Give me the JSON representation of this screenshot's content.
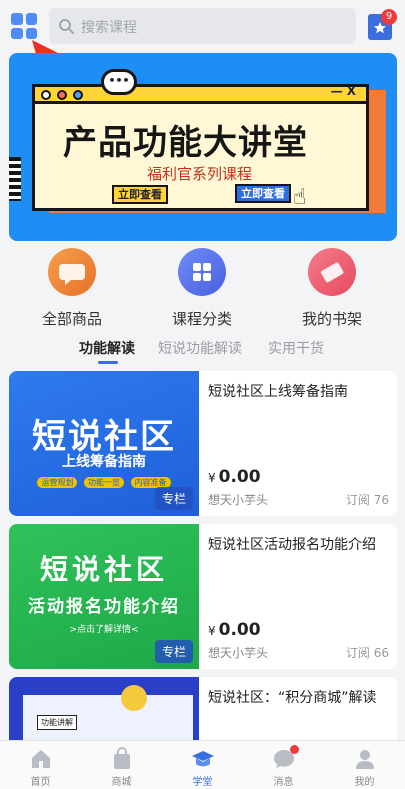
{
  "header": {
    "search_placeholder": "搜索课程",
    "cart_badge": "9"
  },
  "banner": {
    "title": "产品功能大讲堂",
    "subtitle": "福利官系列课程",
    "button_left": "立即查看",
    "button_right": "立即查看",
    "window_controls": "— X"
  },
  "categories": [
    {
      "label": "全部商品",
      "icon": "chat-bubble-icon",
      "color": "#ee8b3a"
    },
    {
      "label": "课程分类",
      "icon": "grid-icon",
      "color": "#5a74ec"
    },
    {
      "label": "我的书架",
      "icon": "ticket-icon",
      "color": "#ee5b6b"
    }
  ],
  "tabs": [
    {
      "label": "功能解读",
      "active": true
    },
    {
      "label": "短说功能解读",
      "active": false
    },
    {
      "label": "实用干货",
      "active": false
    }
  ],
  "courses": [
    {
      "cover_title": "短说社区",
      "cover_subtitle": "上线筹备指南",
      "cover_chips": [
        "运营规划",
        "功能一览",
        "内容准备"
      ],
      "cover_tag": "专栏",
      "title": "短说社区上线筹备指南",
      "price_symbol": "¥",
      "price": "0.00",
      "author": "想天小芋头",
      "views": "订阅 76"
    },
    {
      "cover_title": "短说社区",
      "cover_subtitle": "活动报名功能介绍",
      "cover_note": ">点击了解详情<",
      "cover_tag": "专栏",
      "title": "短说社区活动报名功能介绍",
      "price_symbol": "¥",
      "price": "0.00",
      "author": "想天小芋头",
      "views": "订阅 66"
    },
    {
      "cover_label": "功能讲解",
      "title": "短说社区：“积分商城”解读"
    }
  ],
  "bottom_nav": [
    {
      "label": "首页",
      "icon": "home-icon",
      "active": false
    },
    {
      "label": "商城",
      "icon": "shopping-bag-icon",
      "active": false
    },
    {
      "label": "学堂",
      "icon": "graduation-cap-icon",
      "active": true
    },
    {
      "label": "消息",
      "icon": "message-icon",
      "active": false,
      "dot": true
    },
    {
      "label": "我的",
      "icon": "user-icon",
      "active": false
    }
  ],
  "colors": {
    "accent": "#3b6fe0",
    "banner_bg": "#1f8ef4",
    "alert_red": "#ef3a3a"
  }
}
